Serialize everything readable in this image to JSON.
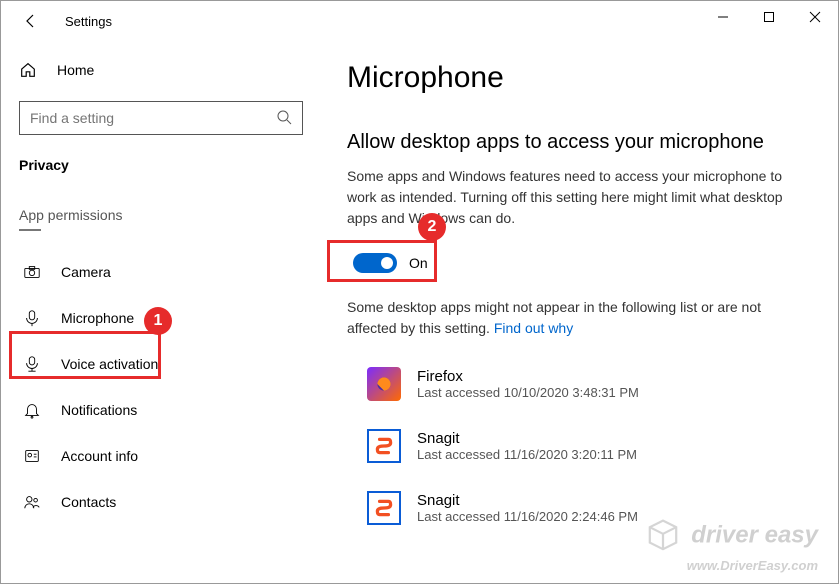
{
  "titlebar": {
    "title": "Settings"
  },
  "sidebar": {
    "home": "Home",
    "search_placeholder": "Find a setting",
    "category": "Privacy",
    "section": "App permissions",
    "items": [
      {
        "icon": "camera-icon",
        "label": "Camera"
      },
      {
        "icon": "microphone-icon",
        "label": "Microphone"
      },
      {
        "icon": "voice-icon",
        "label": "Voice activation"
      },
      {
        "icon": "bell-icon",
        "label": "Notifications"
      },
      {
        "icon": "account-icon",
        "label": "Account info"
      },
      {
        "icon": "contacts-icon",
        "label": "Contacts"
      }
    ]
  },
  "content": {
    "page_title": "Microphone",
    "sub_heading": "Allow desktop apps to access your microphone",
    "description": "Some apps and Windows features need to access your microphone to work as intended. Turning off this setting here might limit what desktop apps and Windows can do.",
    "toggle_label": "On",
    "note_text": "Some desktop apps might not appear in the following list or are not affected by this setting. ",
    "note_link": "Find out why",
    "apps": [
      {
        "name": "Firefox",
        "meta": "Last accessed 10/10/2020 3:48:31 PM"
      },
      {
        "name": "Snagit",
        "meta": "Last accessed 11/16/2020 3:20:11 PM"
      },
      {
        "name": "Snagit",
        "meta": "Last accessed 11/16/2020 2:24:46 PM"
      }
    ]
  },
  "annotations": {
    "callout1": "1",
    "callout2": "2"
  },
  "watermark": {
    "brand": "driver easy",
    "url": "www.DriverEasy.com"
  }
}
